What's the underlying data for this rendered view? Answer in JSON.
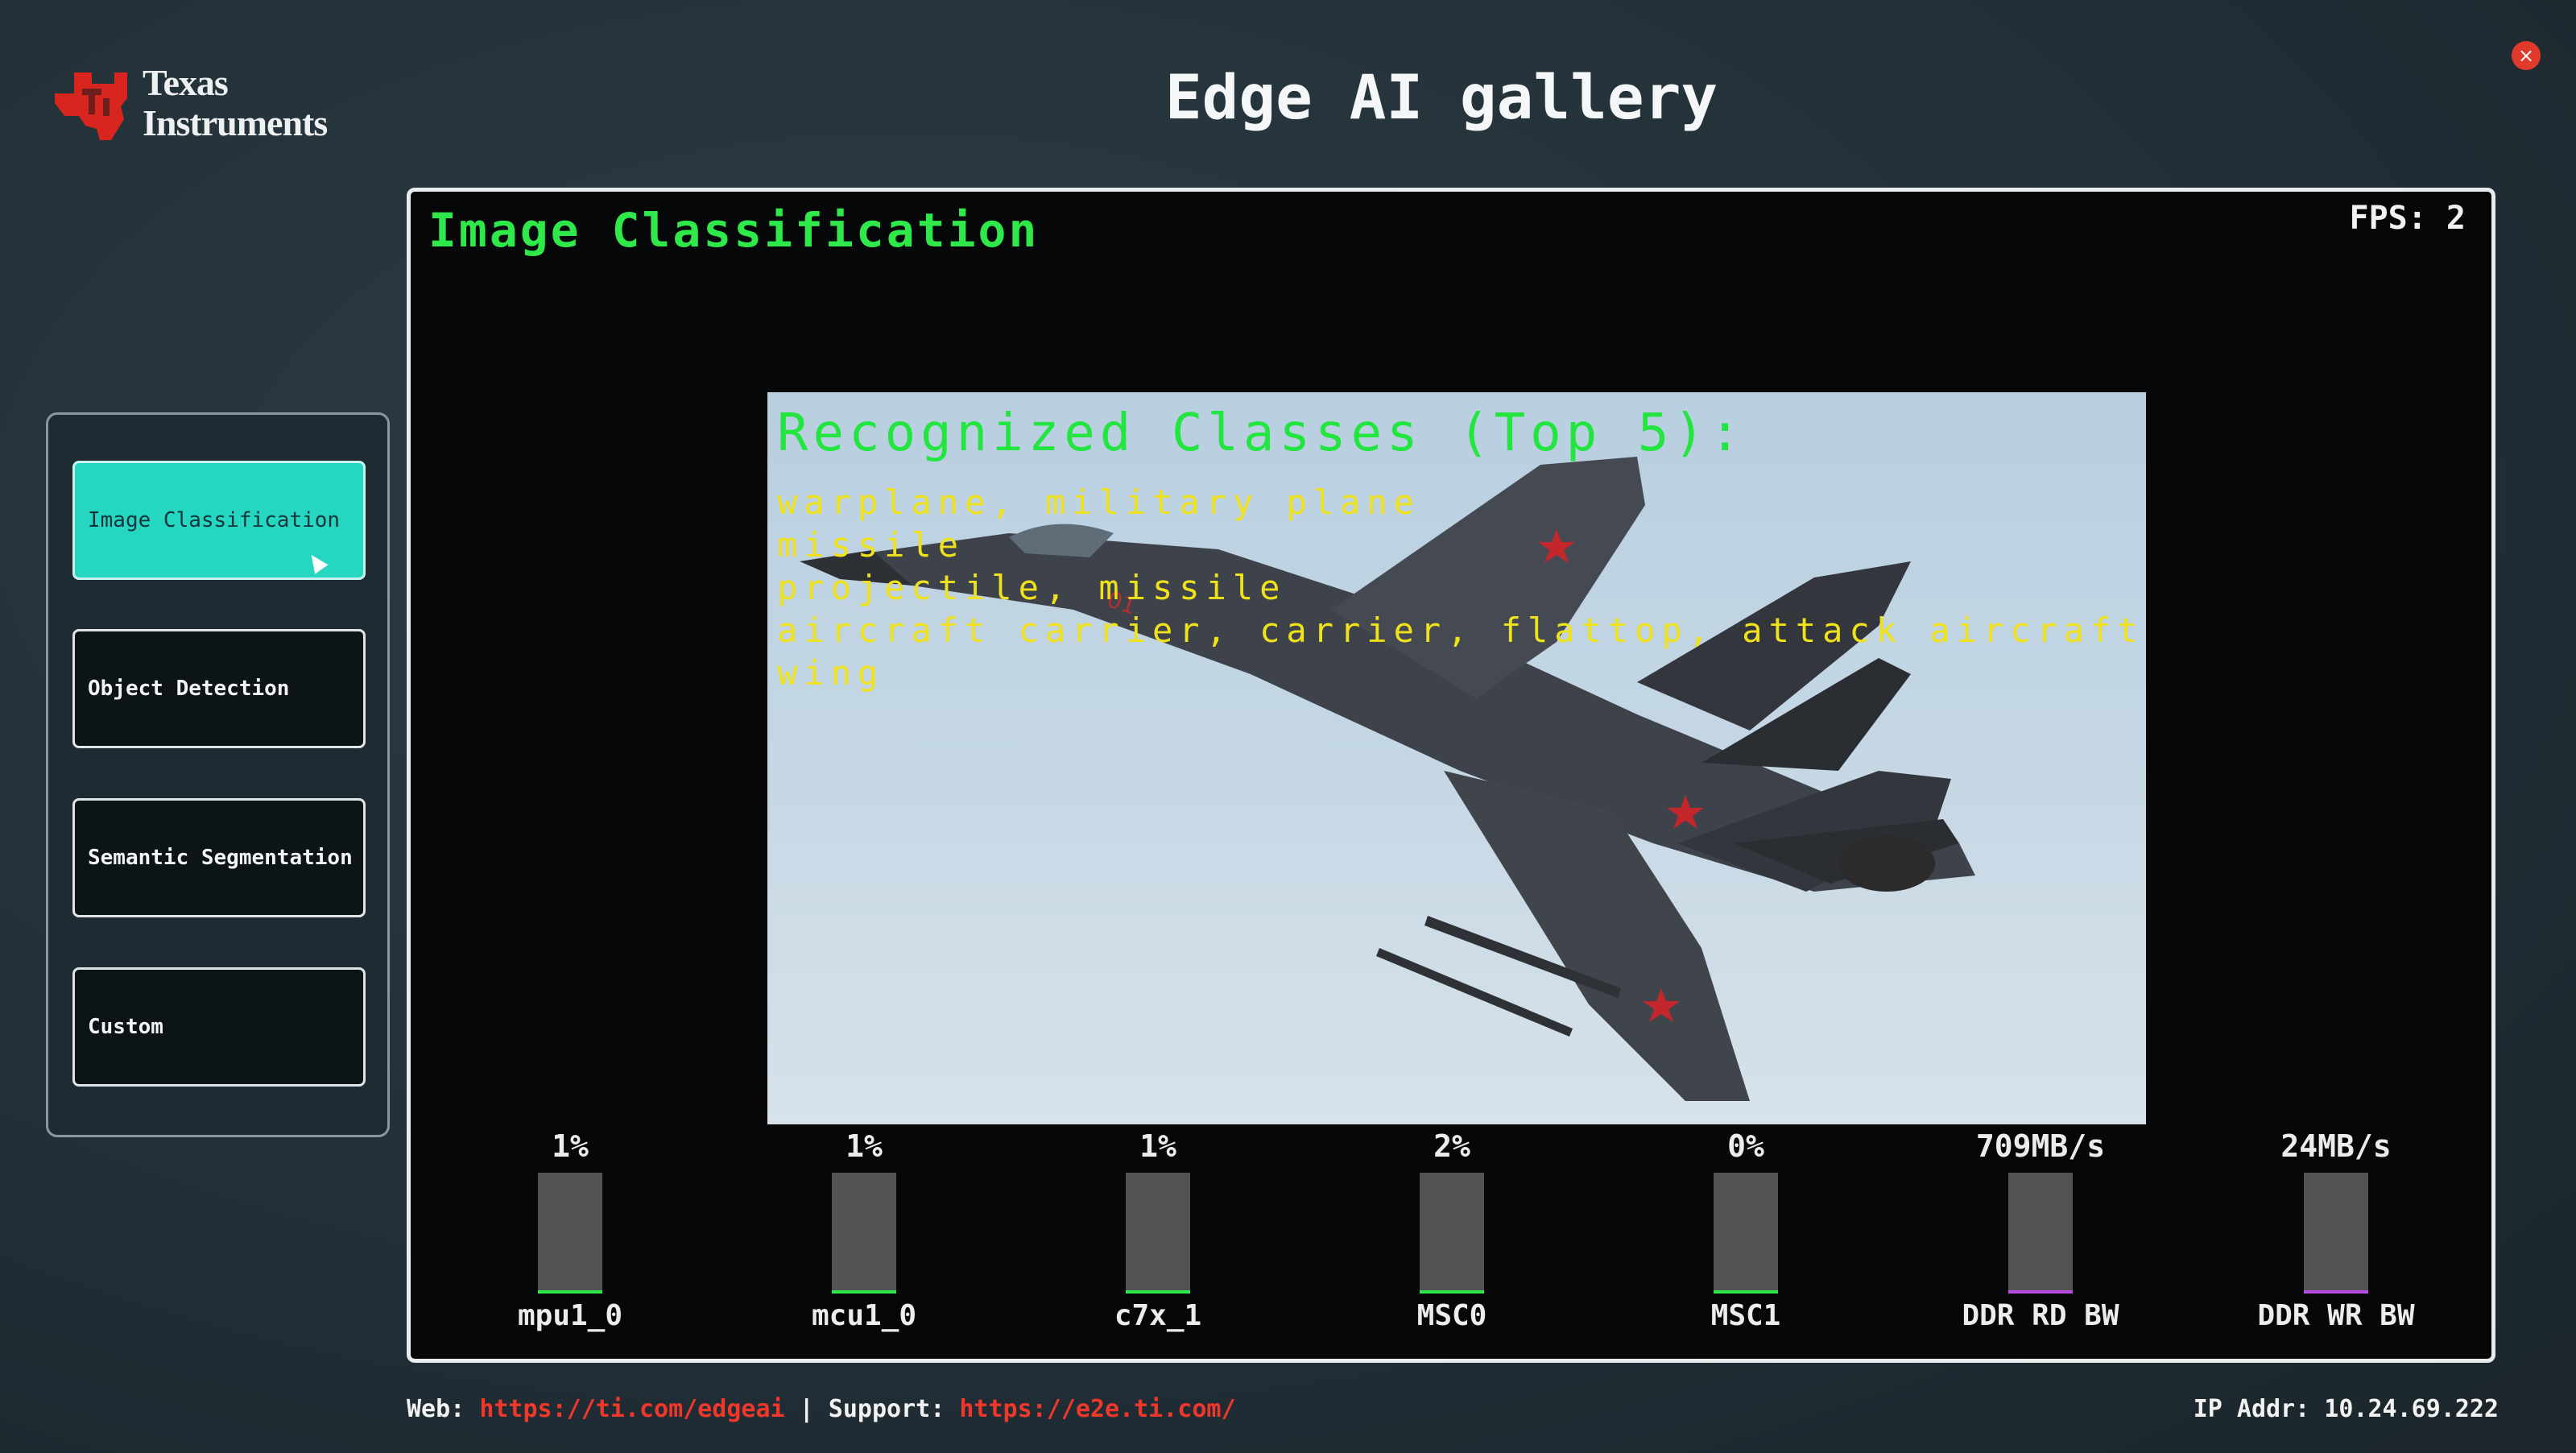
{
  "header": {
    "logo": {
      "line1": "Texas",
      "line2": "Instruments"
    },
    "title": "Edge AI gallery",
    "close_icon": "close-icon",
    "close_symbol": "×"
  },
  "sidebar": {
    "items": [
      {
        "label": "Image Classification",
        "active": true
      },
      {
        "label": "Object Detection",
        "active": false
      },
      {
        "label": "Semantic Segmentation",
        "active": false
      },
      {
        "label": "Custom",
        "active": false
      }
    ]
  },
  "panel": {
    "title": "Image Classification",
    "fps": "FPS: 2"
  },
  "overlay": {
    "heading": "Recognized Classes (Top 5):",
    "classes": [
      "warplane, military plane",
      "missile",
      "projectile, missile",
      "aircraft carrier, carrier, flattop, attack aircraft c",
      "wing"
    ]
  },
  "meters": [
    {
      "label": "mpu1_0",
      "value": "1%",
      "level": 0.01,
      "color": "#2fe84a"
    },
    {
      "label": "mcu1_0",
      "value": "1%",
      "level": 0.01,
      "color": "#2fe84a"
    },
    {
      "label": "c7x_1",
      "value": "1%",
      "level": 0.01,
      "color": "#2fe84a"
    },
    {
      "label": "MSC0",
      "value": "2%",
      "level": 0.02,
      "color": "#2fe84a"
    },
    {
      "label": "MSC1",
      "value": "0%",
      "level": 0.0,
      "color": "#2fe84a"
    },
    {
      "label": "DDR RD BW",
      "value": "709MB/s",
      "level": 0.03,
      "color": "#b84ce0"
    },
    {
      "label": "DDR WR BW",
      "value": "24MB/s",
      "level": 0.0,
      "color": "#b84ce0"
    }
  ],
  "footer": {
    "web_label": "Web:",
    "web_url": "https://ti.com/edgeai",
    "separator": "|",
    "support_label": "Support:",
    "support_url": "https://e2e.ti.com/",
    "ip": "IP Addr: 10.24.69.222"
  },
  "colors": {
    "accent": "#25d6c0",
    "title_green": "#2fe84a",
    "class_yellow": "#f0e21a",
    "link_red": "#f0372b"
  }
}
